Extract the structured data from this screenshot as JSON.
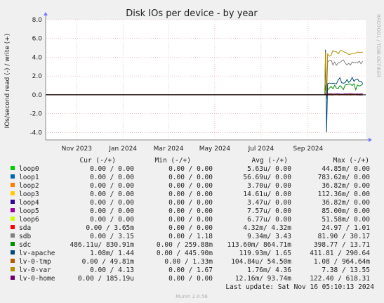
{
  "chart_data": {
    "type": "line",
    "title": "Disk IOs per device - by year",
    "ylabel": "IOs/second read (-) / write (+)",
    "ylim": [
      -4.8,
      8.0
    ],
    "yticks": [
      "-4.0",
      "-2.0",
      "0.0",
      "2.0",
      "4.0",
      "6.0",
      "8.0"
    ],
    "ytick_values": [
      -4,
      -2,
      0,
      2,
      4,
      6,
      8
    ],
    "x_range": [
      "2023-09-21",
      "2024-11-16"
    ],
    "xticks": [
      {
        "label": "Nov 2023",
        "date": "2023-11-01"
      },
      {
        "label": "Jan 2024",
        "date": "2024-01-01"
      },
      {
        "label": "Mar 2024",
        "date": "2024-03-01"
      },
      {
        "label": "May 2024",
        "date": "2024-05-01"
      },
      {
        "label": "Jul 2024",
        "date": "2024-07-01"
      },
      {
        "label": "Sep 2024",
        "date": "2024-09-01"
      }
    ],
    "data_start": "2024-09-24",
    "series": [
      {
        "name": "loop0",
        "color": "#00cc00",
        "typical": 0.0,
        "spike": 0.0
      },
      {
        "name": "loop1",
        "color": "#0066b3",
        "typical": 0.0,
        "spike": 0.78
      },
      {
        "name": "loop2",
        "color": "#ff8000",
        "typical": 0.0,
        "spike": 0.04
      },
      {
        "name": "loop3",
        "color": "#ffcc00",
        "typical": 0.0,
        "spike": 0.11
      },
      {
        "name": "loop4",
        "color": "#330099",
        "typical": 0.0,
        "spike": 0.04
      },
      {
        "name": "loop5",
        "color": "#990099",
        "typical": 0.0,
        "spike": 0.09
      },
      {
        "name": "loop6",
        "color": "#ccff00",
        "typical": 0.0,
        "spike": 0.05
      },
      {
        "name": "sda",
        "color": "#ff0000",
        "typical": 0.0,
        "spike": 1.0
      },
      {
        "name": "sdb",
        "color": "#808080",
        "typical": 3.4,
        "spike": 30.0
      },
      {
        "name": "sdc",
        "color": "#008f00",
        "typical": 0.86,
        "spike": 13.7
      },
      {
        "name": "lv-apache",
        "color": "#00487d",
        "typical": 1.5,
        "spike": 290.0
      },
      {
        "name": "lv-0-tmp",
        "color": "#b35a00",
        "typical": 0.05,
        "spike": 0.96
      },
      {
        "name": "lv-0-var",
        "color": "#b38f00",
        "typical": 4.4,
        "spike": 13.5
      },
      {
        "name": "lv-0-home",
        "color": "#6b006b",
        "typical": 0.09,
        "spike": 0.6
      }
    ]
  },
  "legend": {
    "headers": {
      "cur": "Cur (-/+)",
      "min": "Min (-/+)",
      "avg": "Avg (-/+)",
      "max": "Max (-/+)"
    },
    "rows": [
      {
        "name": "loop0",
        "color": "#00cc00",
        "cur": "0.00 /    0.00",
        "min": "0.00 /    0.00",
        "avg": "5.63u/    0.00",
        "max": "44.85m/   0.00"
      },
      {
        "name": "loop1",
        "color": "#0066b3",
        "cur": "0.00 /    0.00",
        "min": "0.00 /    0.00",
        "avg": "56.69u/    0.00",
        "max": "783.62m/   0.00"
      },
      {
        "name": "loop2",
        "color": "#ff8000",
        "cur": "0.00 /    0.00",
        "min": "0.00 /    0.00",
        "avg": "3.70u/    0.00",
        "max": "36.82m/   0.00"
      },
      {
        "name": "loop3",
        "color": "#ffcc00",
        "cur": "0.00 /    0.00",
        "min": "0.00 /    0.00",
        "avg": "14.61u/    0.00",
        "max": "112.36m/   0.00"
      },
      {
        "name": "loop4",
        "color": "#330099",
        "cur": "0.00 /    0.00",
        "min": "0.00 /    0.00",
        "avg": "3.47u/    0.00",
        "max": "36.82m/   0.00"
      },
      {
        "name": "loop5",
        "color": "#990099",
        "cur": "0.00 /    0.00",
        "min": "0.00 /    0.00",
        "avg": "7.57u/    0.00",
        "max": "85.00m/   0.00"
      },
      {
        "name": "loop6",
        "color": "#ccff00",
        "cur": "0.00 /    0.00",
        "min": "0.00 /    0.00",
        "avg": "6.77u/    0.00",
        "max": "51.58m/   0.00"
      },
      {
        "name": "sda",
        "color": "#ff0000",
        "cur": "0.00 /   3.65m",
        "min": "0.00 /    0.00",
        "avg": "4.32m/   4.32m",
        "max": "24.97 /   1.01"
      },
      {
        "name": "sdb",
        "color": "#808080",
        "cur": "0.00 /    3.15",
        "min": "0.00 /    1.18",
        "avg": "9.34m/    3.43",
        "max": "81.90 /  30.17"
      },
      {
        "name": "sdc",
        "color": "#008f00",
        "cur": "486.11u/ 830.91m",
        "min": "0.00 / 259.88m",
        "avg": "113.60m/ 864.71m",
        "max": "398.77 /  13.71"
      },
      {
        "name": "lv-apache",
        "color": "#00487d",
        "cur": "1.08m/    1.44",
        "min": "0.00 / 445.90m",
        "avg": "119.93m/    1.65",
        "max": "411.81 / 290.64"
      },
      {
        "name": "lv-0-tmp",
        "color": "#b35a00",
        "cur": "0.00 /  49.81m",
        "min": "0.00 /   1.33m",
        "avg": "104.84u/  54.50m",
        "max": "1.08 / 964.64m"
      },
      {
        "name": "lv-0-var",
        "color": "#b38f00",
        "cur": "0.00 /    4.13",
        "min": "0.00 /    1.67",
        "avg": "1.76m/    4.36",
        "max": "7.38 /  13.55"
      },
      {
        "name": "lv-0-home",
        "color": "#6b006b",
        "cur": "0.00 / 185.19u",
        "min": "0.00 /    0.00",
        "avg": "12.16m/  93.74m",
        "max": "122.40 / 618.31"
      }
    ]
  },
  "side_label": "RRDTOOL / TOBI OETIKER",
  "last_update": "Last update: Sat Nov 16 05:10:13 2024",
  "footer": "Munin 2.0.56",
  "colors": {
    "background": "#f0f0f0",
    "plot": "#ffffff",
    "grid": "#e2a0a0",
    "zero_line": "#000000"
  }
}
